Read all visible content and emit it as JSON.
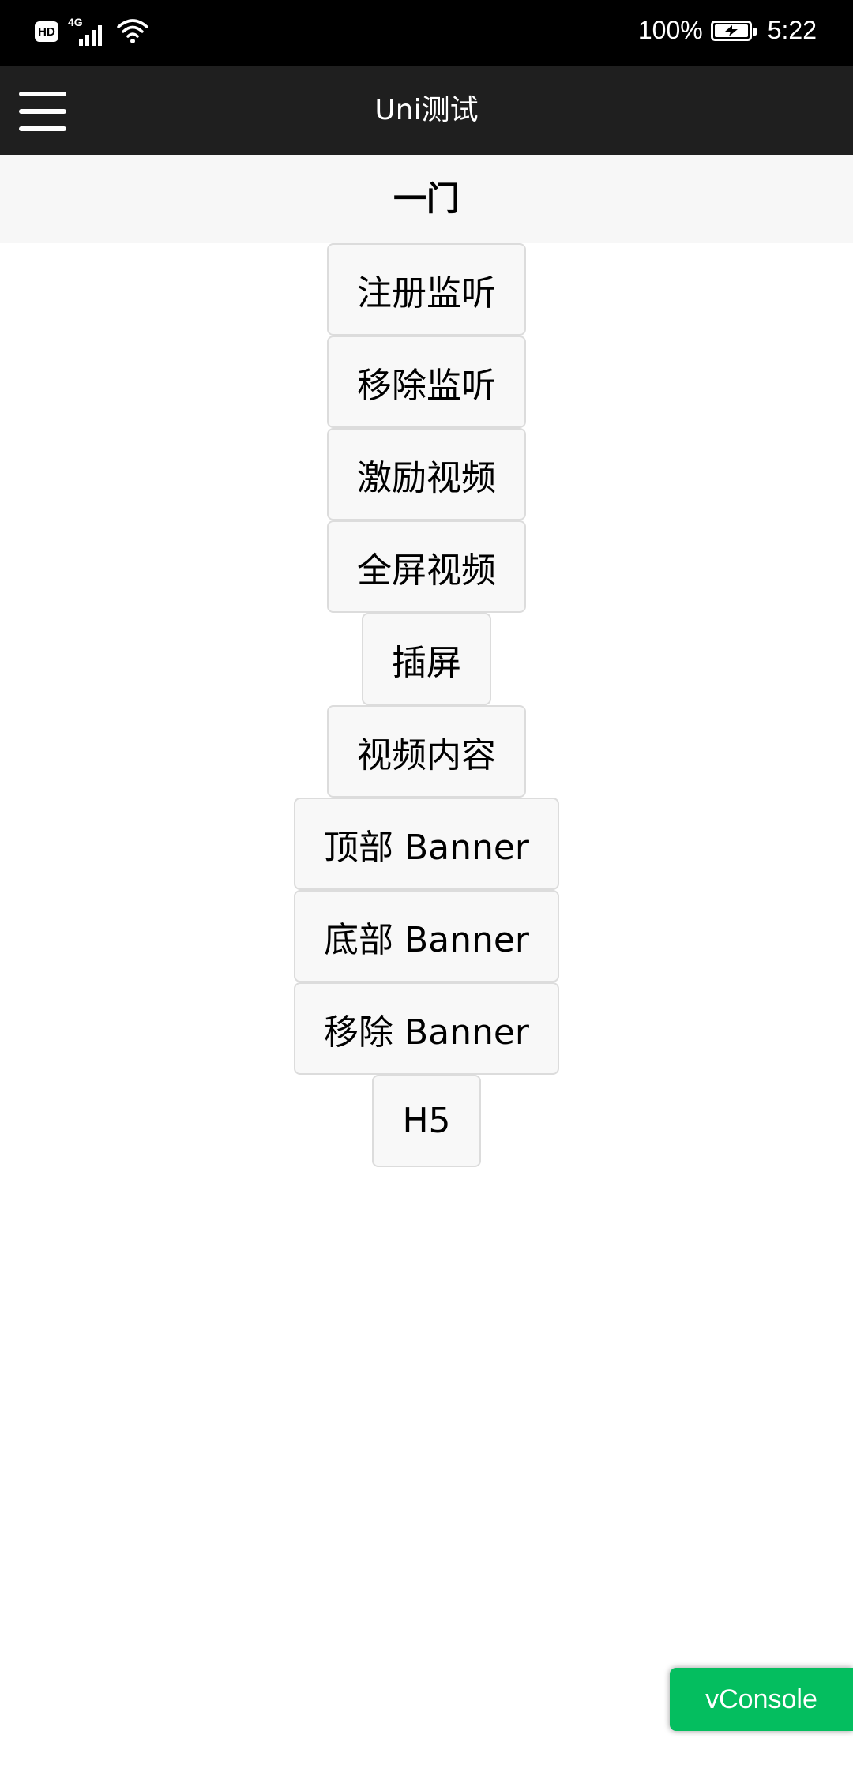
{
  "status_bar": {
    "hd_label": "HD",
    "network_label": "4G",
    "battery_text": "100%",
    "time": "5:22",
    "battery_level": 1.0
  },
  "nav": {
    "title": "Uni测试",
    "menu_icon": "hamburger-menu-icon"
  },
  "section": {
    "title": "一门"
  },
  "buttons": [
    {
      "label": "注册监听"
    },
    {
      "label": "移除监听"
    },
    {
      "label": "激励视频"
    },
    {
      "label": "全屏视频"
    },
    {
      "label": "插屏"
    },
    {
      "label": "视频内容"
    },
    {
      "label": "顶部 Banner"
    },
    {
      "label": "底部 Banner"
    },
    {
      "label": "移除 Banner"
    },
    {
      "label": "H5"
    }
  ],
  "vconsole": {
    "label": "vConsole"
  },
  "colors": {
    "status_bar_bg": "#000000",
    "nav_bg": "#1f1f1f",
    "section_bg": "#f7f7f7",
    "button_bg": "#f8f8f8",
    "vconsole_green": "#04be5f"
  }
}
